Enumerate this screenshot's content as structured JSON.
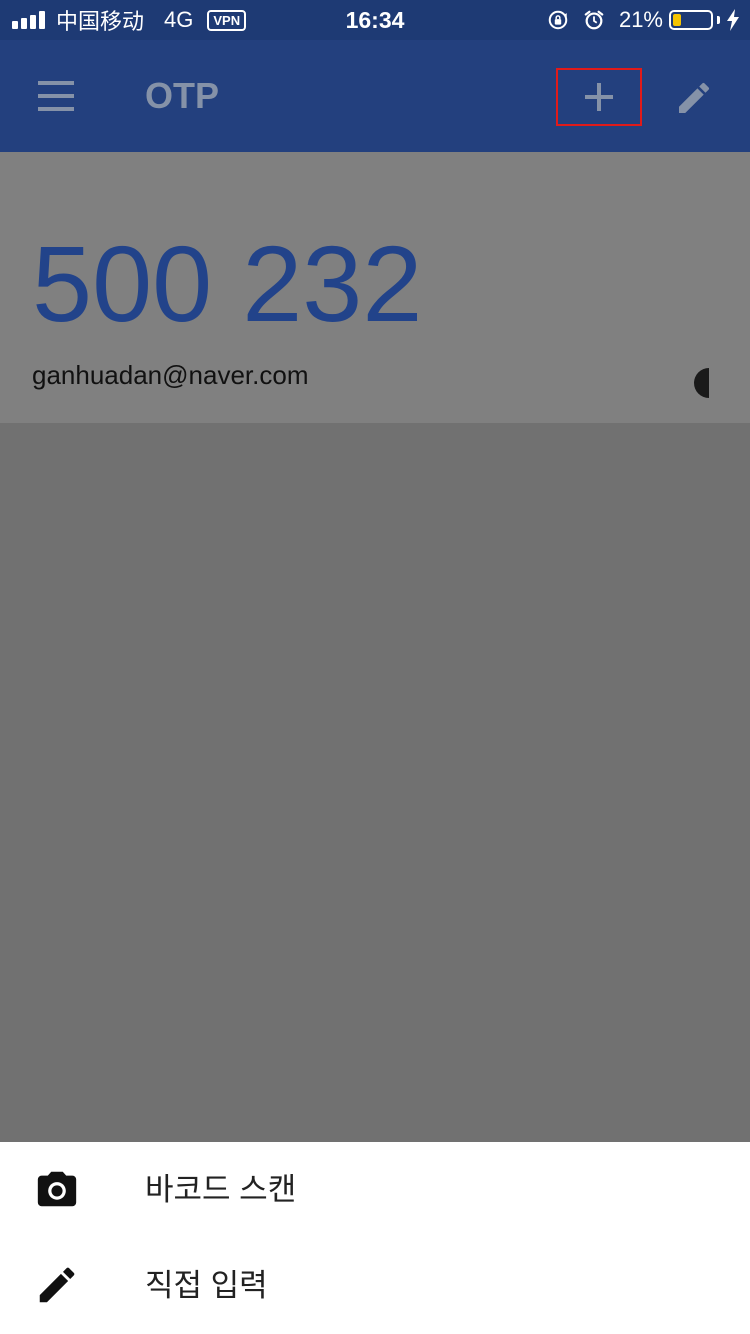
{
  "status_bar": {
    "carrier": "中国移动",
    "network": "4G",
    "vpn": "VPN",
    "time": "16:34",
    "battery_percent": "21%",
    "battery_level": 0.21,
    "battery_color": "#f5c400",
    "icons": [
      "signal-icon",
      "rotation-lock-icon",
      "alarm-icon",
      "battery-icon",
      "charging-icon"
    ]
  },
  "app_bar": {
    "title": "OTP",
    "icons": [
      "menu-icon",
      "plus-icon",
      "pencil-icon"
    ],
    "background": "#23407e"
  },
  "otp": {
    "code": "500 232",
    "account": "ganhuadan@naver.com",
    "code_color": "#22438a"
  },
  "bottom_sheet": {
    "items": [
      {
        "icon": "camera-icon",
        "label": "바코드 스캔"
      },
      {
        "icon": "pencil-icon",
        "label": "직접 입력"
      }
    ]
  },
  "highlight_color": "#e01a1a"
}
